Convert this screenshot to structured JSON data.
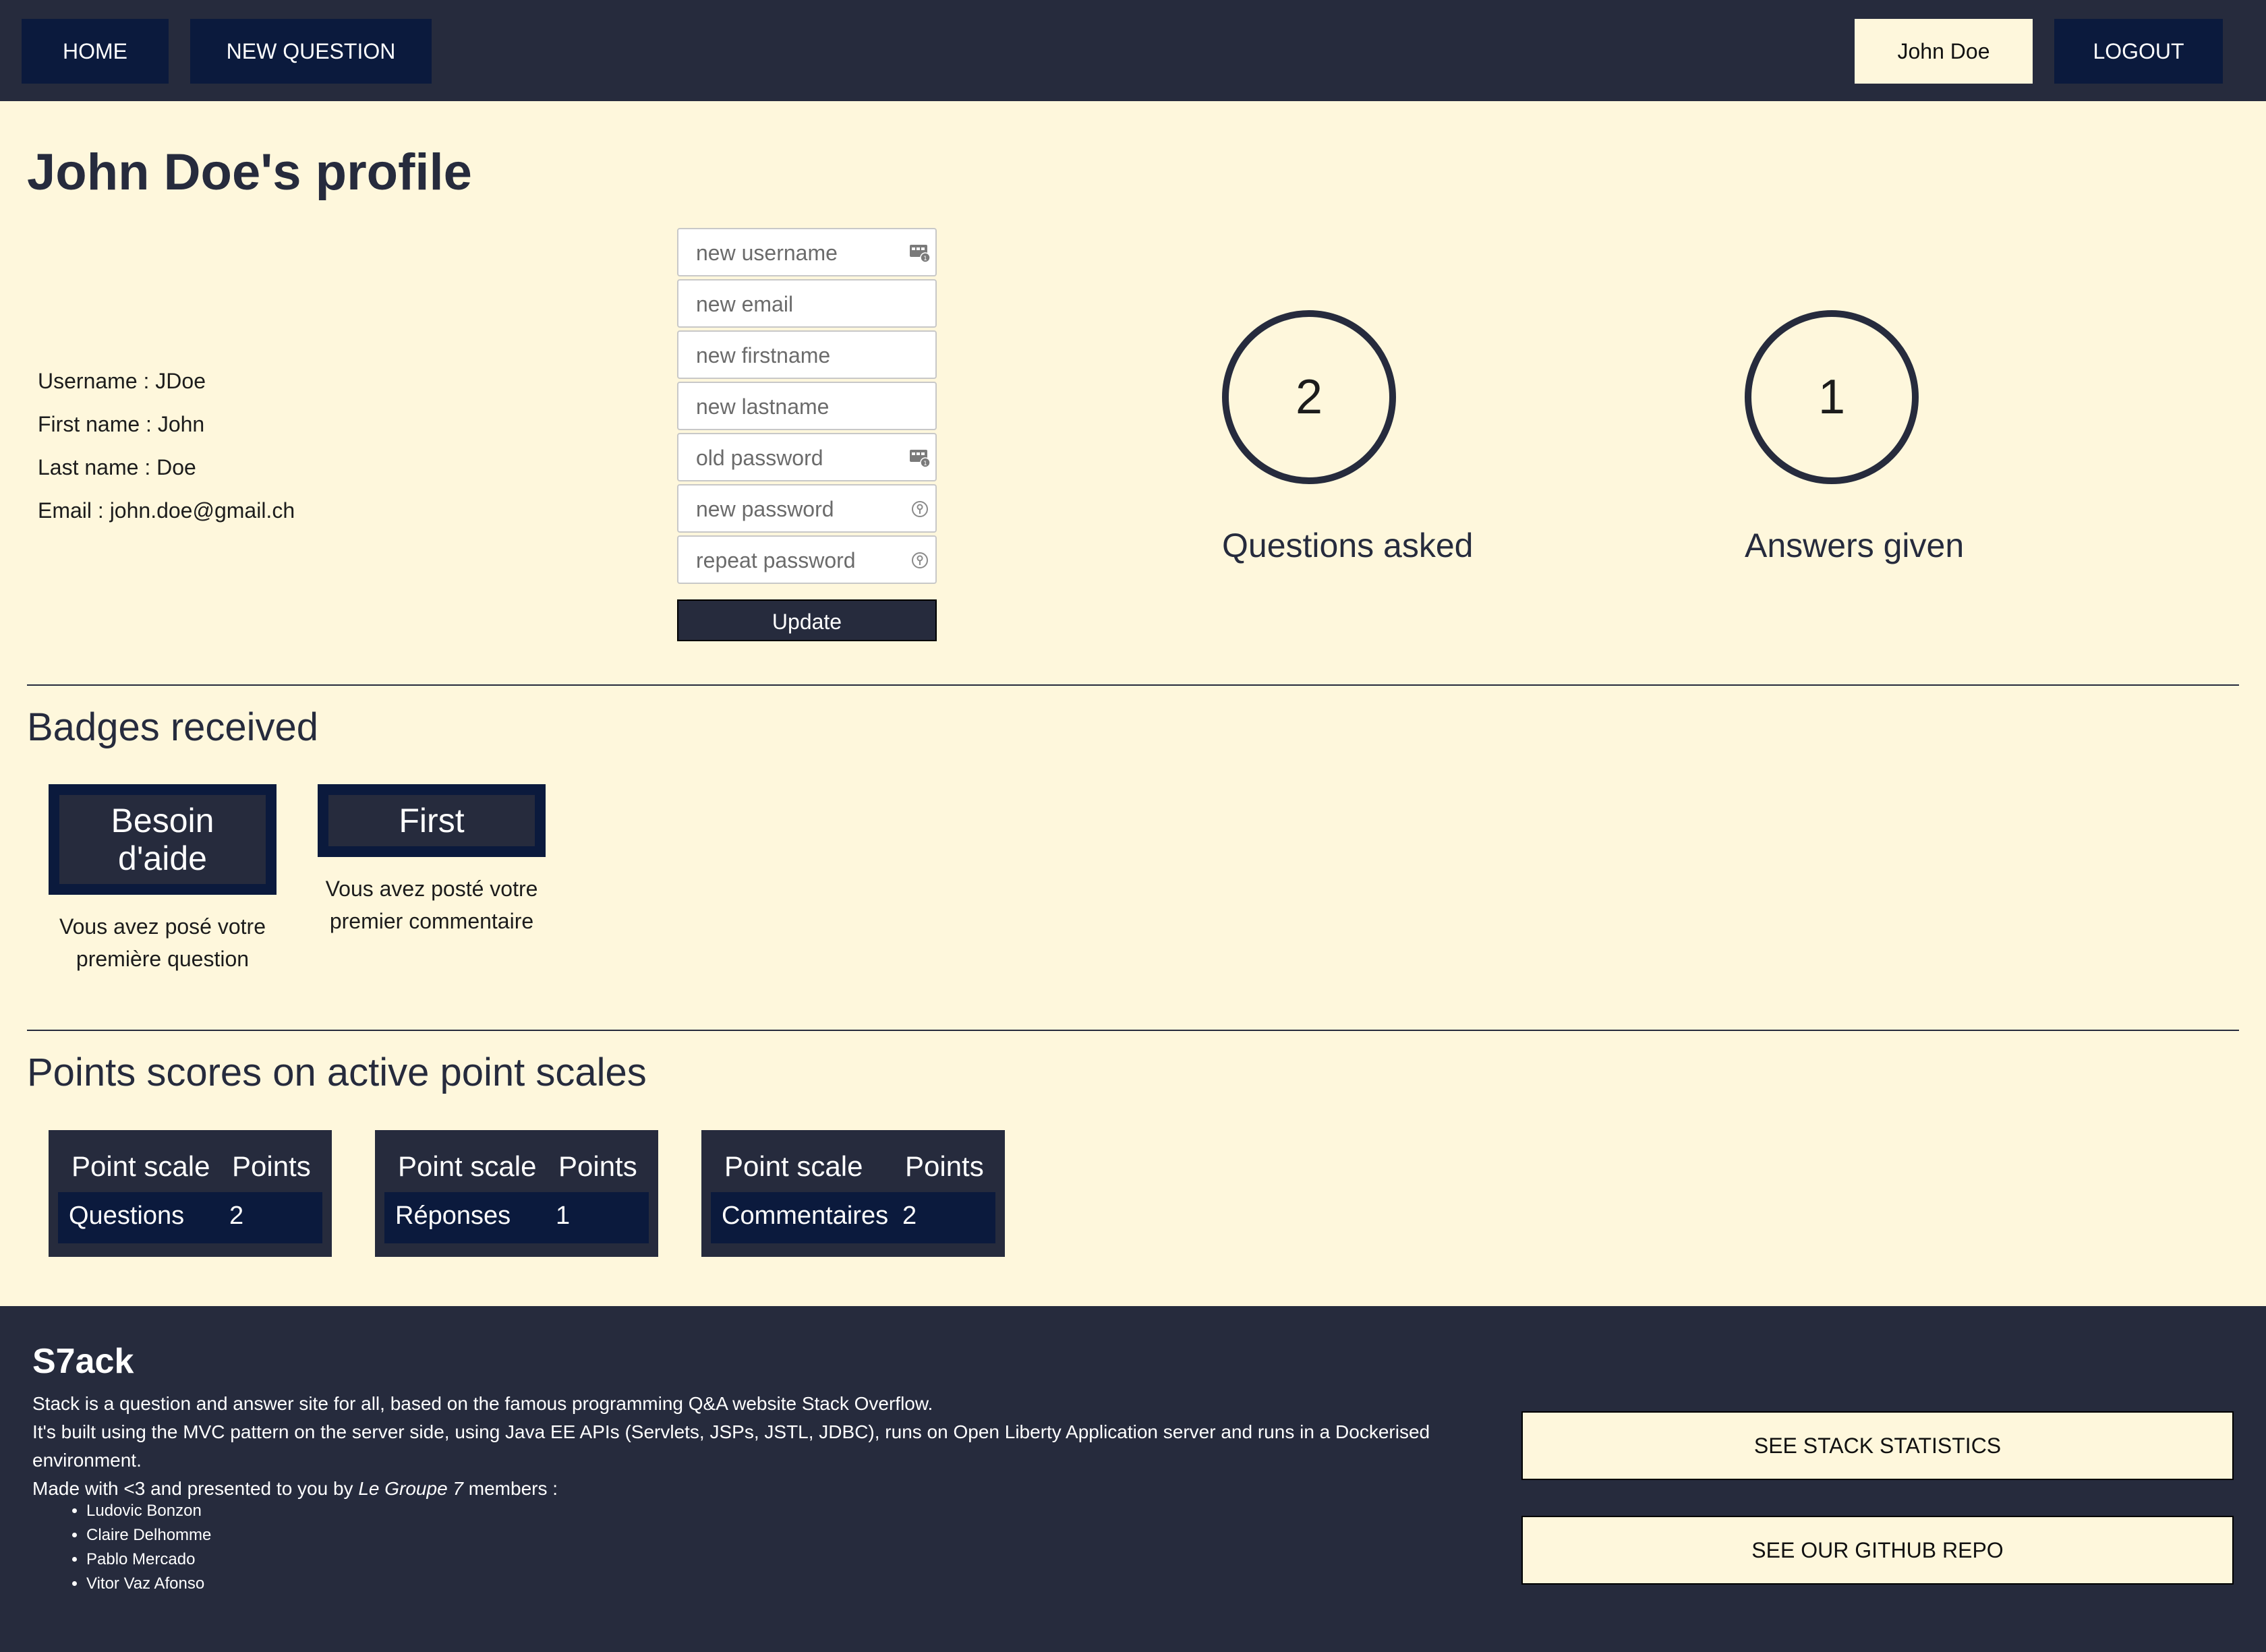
{
  "nav": {
    "home": "HOME",
    "new_question": "NEW QUESTION",
    "user": "John Doe",
    "logout": "LOGOUT"
  },
  "profile": {
    "title": "John Doe's profile",
    "info": [
      "Username : JDoe",
      "First name : John",
      "Last name : Doe",
      "Email : john.doe@gmail.ch"
    ]
  },
  "form": {
    "placeholders": {
      "username": "new username",
      "email": "new email",
      "firstname": "new firstname",
      "lastname": "new lastname",
      "old_password": "old password",
      "new_password": "new password",
      "repeat_password": "repeat password"
    },
    "update": "Update"
  },
  "stats": {
    "questions": {
      "value": "2",
      "label": "Questions asked"
    },
    "answers": {
      "value": "1",
      "label": "Answers given"
    }
  },
  "badges": {
    "title": "Badges received",
    "items": [
      {
        "name": "Besoin d'aide",
        "desc": "Vous avez posé votre première question"
      },
      {
        "name": "First",
        "desc": "Vous avez posté votre premier commentaire"
      }
    ]
  },
  "points": {
    "title": "Points scores on active point scales",
    "col_scale": "Point scale",
    "col_points": "Points",
    "rows": [
      {
        "scale": "Questions",
        "points": "2"
      },
      {
        "scale": "Réponses",
        "points": "1"
      },
      {
        "scale": "Commentaires",
        "points": "2"
      }
    ]
  },
  "footer": {
    "brand": "S7ack",
    "line1": "Stack is a question and answer site for all, based on the famous programming Q&A website Stack Overflow.",
    "line2": "It's built using the MVC pattern on the server side, using Java EE APIs (Servlets, JSPs, JSTL, JDBC), runs on Open Liberty Application server and runs in a Dockerised environment.",
    "line3_prefix": "Made with <3 and presented to you by ",
    "line3_group": "Le Groupe 7",
    "line3_suffix": " members :",
    "members": [
      "Ludovic Bonzon",
      "Claire Delhomme",
      "Pablo Mercado",
      "Vitor Vaz Afonso"
    ],
    "stats_button": "SEE STACK STATISTICS",
    "github_button": "SEE OUR GITHUB REPO"
  },
  "colors": {
    "background": "#fef7dc",
    "navbar": "#262b3d",
    "nav_button": "#0b1a3d"
  },
  "icons": {
    "username_field": "contact-card-icon",
    "password_field": "contact-card-icon",
    "new_password_field": "key-icon"
  }
}
